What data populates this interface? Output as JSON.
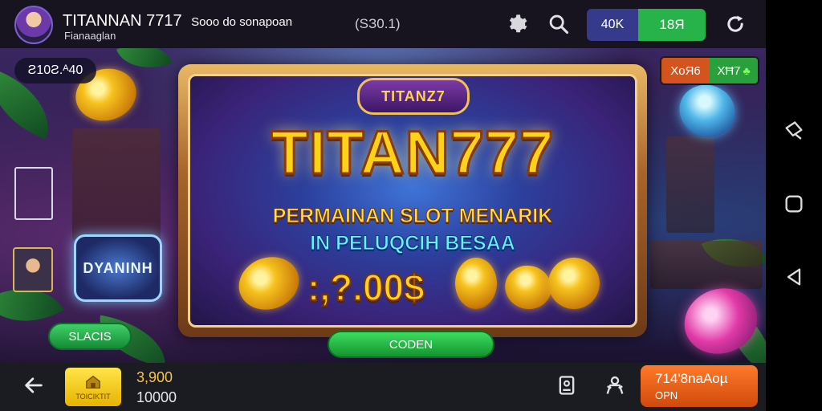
{
  "header": {
    "title": "TITANNAN 7717",
    "title_sub": "Sooo do sonapoan",
    "subtitle": "Fianaaglan",
    "status": "(SЗ0.1)",
    "toggle_left": "40K",
    "toggle_right": "18Я"
  },
  "stage": {
    "balance": "Ƨ10Ƨ.ᴬ40",
    "brand_badge": "DYANINH",
    "side_button": "SLACIS",
    "chips_badge": {
      "left": "XoЯ6",
      "right": "XĦ7"
    },
    "center_button": "CODEN"
  },
  "banner": {
    "mini_logo": "TITANZ7",
    "title": "TITAN777",
    "line1": "PERMAINAN SLOT MENARIK",
    "line2": "IN PELUQCIH BESAA",
    "amount": ":,?.00$"
  },
  "footer": {
    "home_label": "TOICIKTIT",
    "stat_top": "3,900",
    "stat_bottom": "10000",
    "bet_line1": "714'8naAoµ",
    "bet_line2": "OPN"
  },
  "icons": {
    "gear": "gear-icon",
    "search": "search-icon",
    "refresh": "refresh-icon",
    "back": "back-arrow-icon",
    "doc": "document-icon",
    "person": "person-icon"
  },
  "colors": {
    "toggle_blue": "#363a8a",
    "toggle_green": "#28b34a",
    "cta_green": "#1fb342",
    "bet_orange": "#e05b14",
    "gold_text": "#ffd21a"
  }
}
